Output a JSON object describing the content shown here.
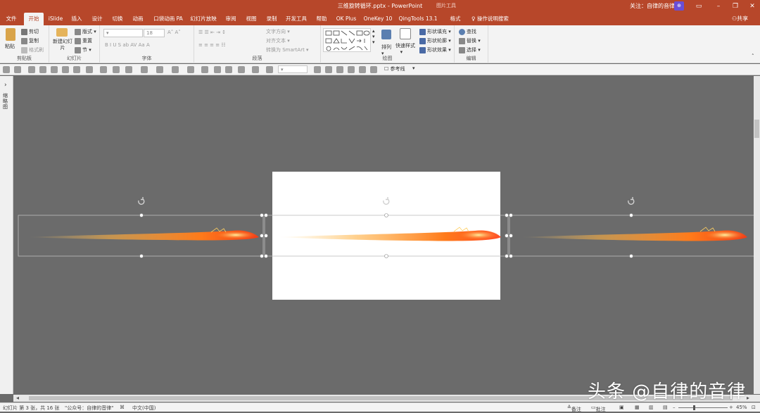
{
  "titlebar": {
    "title": "三维旋转循环.pptx  -  PowerPoint",
    "picture_tools": "图片工具",
    "follow": "关注：自律的音律",
    "avatar": "⊕"
  },
  "tabs": [
    "文件",
    "开始",
    "iSlide",
    "插入",
    "设计",
    "切换",
    "动画",
    "口袋动画 PA",
    "幻灯片放映",
    "审阅",
    "视图",
    "录制",
    "开发工具",
    "帮助",
    "OK Plus",
    "OneKey 10",
    "QingTools 13.1",
    "格式"
  ],
  "active_tab": "开始",
  "tell_me": "操作说明搜索",
  "share": "共享",
  "ribbon": {
    "clipboard": {
      "paste": "粘贴",
      "cut": "剪切",
      "copy": "复制",
      "format_painter": "格式刷",
      "label": "剪贴板"
    },
    "slides": {
      "new_slide": "新建幻灯片",
      "layout": "版式",
      "reset": "重置",
      "section": "节",
      "label": "幻灯片"
    },
    "font": {
      "font_size": "18",
      "label": "字体"
    },
    "paragraph": {
      "text_direction": "文字方向",
      "align_text": "对齐文本",
      "smartart": "转换为 SmartArt",
      "label": "段落"
    },
    "drawing": {
      "arrange": "排列",
      "quick_styles": "快速样式",
      "shape_fill": "形状填充",
      "shape_outline": "形状轮廓",
      "shape_effects": "形状效果",
      "label": "绘图"
    },
    "editing": {
      "find": "查找",
      "replace": "替换",
      "select": "选择",
      "label": "编辑"
    }
  },
  "qat": {
    "guides": "参考线"
  },
  "left_pane": {
    "label": "缩略图"
  },
  "watermark": "头条 @自律的音律",
  "status": {
    "slide_info": "幻灯片 第 3 张，共 16 张",
    "author": "\"公众号：自律的音律\"",
    "language": "中文(中国)",
    "notes": "备注",
    "comments": "批注",
    "zoom": "45%"
  },
  "colors": {
    "accent": "#b7472a",
    "canvas": "#6b6b6b",
    "flame": "#ff7a1a"
  }
}
